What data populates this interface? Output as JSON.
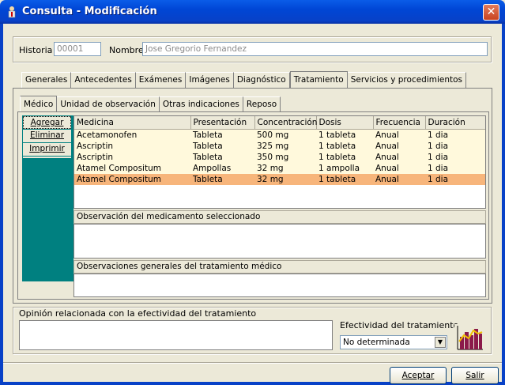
{
  "window": {
    "title": "Consulta - Modificación",
    "close_glyph": "✕"
  },
  "patient": {
    "historia_label": "Historia",
    "historia_value": "00001",
    "nombre_label": "Nombre",
    "nombre_value": "Jose Gregorio Fernandez"
  },
  "main_tabs": [
    "Generales",
    "Antecedentes",
    "Exámenes",
    "Imágenes",
    "Diagnóstico",
    "Tratamiento",
    "Servicios y procedimientos"
  ],
  "active_main_tab": "Tratamiento",
  "sub_tabs": [
    "Médico",
    "Unidad de observación",
    "Otras indicaciones",
    "Reposo"
  ],
  "active_sub_tab": "Médico",
  "sidebar": {
    "add": "Agregar",
    "delete": "Eliminar",
    "print": "Imprimir"
  },
  "table": {
    "columns": [
      "Medicina",
      "Presentación",
      "Concentración",
      "Dosis",
      "Frecuencia",
      "Duración"
    ],
    "rows": [
      [
        "Acetamonofen",
        "Tableta",
        "500 mg",
        "1 tableta",
        "Anual",
        "1 dia"
      ],
      [
        "Ascriptin",
        "Tableta",
        "325 mg",
        "1 tableta",
        "Anual",
        "1 dia"
      ],
      [
        "Ascriptin",
        "Tableta",
        "350 mg",
        "1 tableta",
        "Anual",
        "1 dia"
      ],
      [
        "Atamel Compositum",
        "Ampollas",
        "32 mg",
        "1 ampolla",
        "Anual",
        "1 dia"
      ],
      [
        "Atamel Compositum",
        "Tableta",
        "32 mg",
        "1 tableta",
        "Anual",
        "1 dia"
      ]
    ],
    "selected_row": 4
  },
  "obs_med_label": "Observación del medicamento seleccionado",
  "obs_gen_label": "Observaciones generales del tratamiento médico",
  "opinion_label": "Opinión relacionada con la efectividad del tratamiento",
  "efectividad": {
    "label": "Efectividad del tratamiento",
    "value": "No determinada",
    "chart_icon": "bar-chart-icon"
  },
  "buttons": {
    "ok": "Aceptar",
    "exit": "Salir"
  },
  "colors": {
    "titlebar": "#0a5ce8",
    "sidebar": "#008080",
    "selected_row": "#f7b57b",
    "row_bg": "#fff9dc"
  }
}
